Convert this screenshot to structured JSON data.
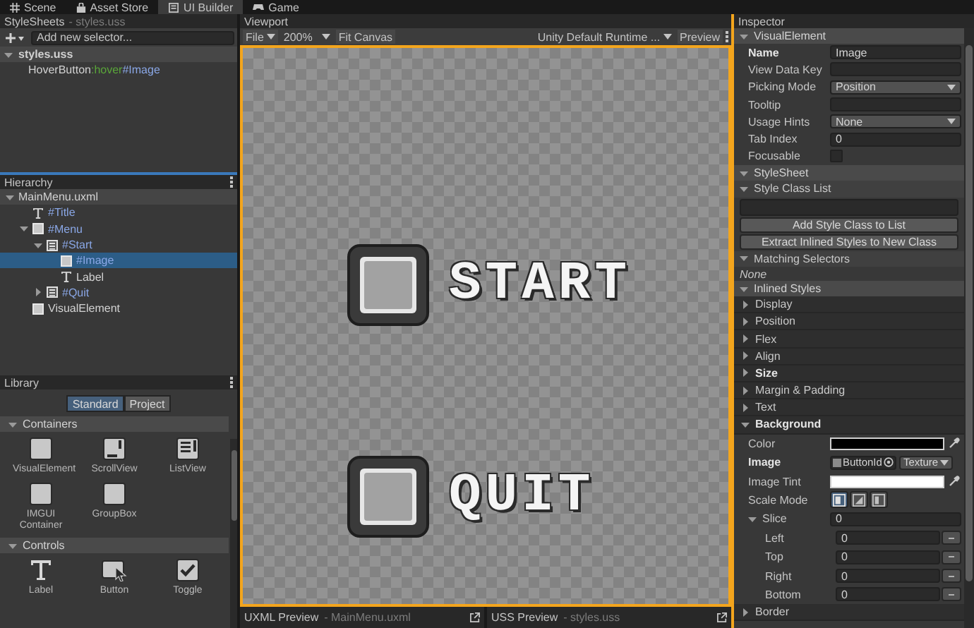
{
  "top_tabs": [
    {
      "label": "Scene",
      "selected": false
    },
    {
      "label": "Asset Store",
      "selected": false
    },
    {
      "label": "UI Builder",
      "selected": true
    },
    {
      "label": "Game",
      "selected": false
    }
  ],
  "stylesheets": {
    "title": "StyleSheets",
    "subtitle": "- styles.uss",
    "selector_placeholder": "Add new selector...",
    "items": [
      {
        "label": "styles.uss",
        "expanded": true,
        "selectors": [
          [
            {
              "text": "HoverButton",
              "kind": "class"
            },
            {
              "text": ":hover",
              "kind": "pseudo"
            },
            {
              "text": "#Image",
              "kind": "id"
            }
          ]
        ]
      }
    ]
  },
  "hierarchy": {
    "title": "Hierarchy",
    "items": [
      {
        "label": "MainMenu.uxml",
        "named": false,
        "selected": false,
        "expanded": true,
        "children": [
          {
            "label": "#Title",
            "kind": "text",
            "named": true,
            "selected": false
          },
          {
            "label": "#Menu",
            "kind": "element",
            "named": true,
            "selected": false,
            "expanded": true,
            "children": [
              {
                "label": "#Start",
                "kind": "template",
                "named": true,
                "selected": false,
                "expanded": true,
                "children": [
                  {
                    "label": "#Image",
                    "kind": "element",
                    "named": true,
                    "selected": true
                  },
                  {
                    "label": "Label",
                    "kind": "text",
                    "named": false,
                    "selected": false
                  }
                ]
              },
              {
                "label": "#Quit",
                "kind": "template",
                "named": true,
                "selected": false,
                "expanded": false
              }
            ]
          },
          {
            "label": "VisualElement",
            "kind": "element",
            "named": false,
            "selected": false
          }
        ]
      }
    ]
  },
  "library": {
    "title": "Library",
    "tabs": [
      {
        "label": "Standard",
        "selected": true
      },
      {
        "label": "Project",
        "selected": false
      }
    ],
    "sections": [
      {
        "title": "Containers",
        "expanded": true,
        "items": [
          {
            "label": "VisualElement",
            "kind": "square"
          },
          {
            "label": "ScrollView",
            "kind": "scrollview"
          },
          {
            "label": "ListView",
            "kind": "listview"
          },
          {
            "label": "IMGUI Container",
            "kind": "square"
          },
          {
            "label": "GroupBox",
            "kind": "square"
          }
        ]
      },
      {
        "title": "Controls",
        "expanded": true,
        "items": [
          {
            "label": "Label",
            "kind": "label"
          },
          {
            "label": "Button",
            "kind": "button"
          },
          {
            "label": "Toggle",
            "kind": "toggle"
          }
        ]
      }
    ]
  },
  "viewport": {
    "title": "Viewport",
    "toolbar": {
      "file": "File",
      "zoom": "200%",
      "fit": "Fit Canvas",
      "theme": "Unity Default Runtime ...",
      "preview": "Preview"
    },
    "canvas": {
      "buttons": [
        {
          "label": "START"
        },
        {
          "label": "QUIT"
        }
      ]
    }
  },
  "previews": [
    {
      "title": "UXML Preview",
      "file": "- MainMenu.uxml"
    },
    {
      "title": "USS Preview",
      "file": "- styles.uss"
    }
  ],
  "inspector": {
    "title": "Inspector",
    "sections": [
      {
        "title": "VisualElement",
        "kind": "fields",
        "expanded": true,
        "fields": [
          {
            "label": "Name",
            "kind": "text",
            "value": "Image",
            "overridden": true
          },
          {
            "label": "View Data Key",
            "kind": "text",
            "overridden": false
          },
          {
            "label": "Picking Mode",
            "kind": "dropdown",
            "value": "Position",
            "overridden": false
          },
          {
            "label": "Tooltip",
            "kind": "text",
            "overridden": false
          },
          {
            "label": "Usage Hints",
            "kind": "dropdown",
            "value": "None",
            "overridden": false
          },
          {
            "label": "Tab Index",
            "kind": "text",
            "value": "0",
            "overridden": false
          },
          {
            "label": "Focusable",
            "kind": "checkbox",
            "checked": false,
            "overridden": false
          }
        ]
      },
      {
        "title": "StyleSheet",
        "kind": "stylesheet",
        "expanded": true,
        "class_list": {
          "title": "Style Class List",
          "expanded": true,
          "buttons": [
            "Add Style Class to List",
            "Extract Inlined Styles to New Class"
          ]
        },
        "matching": {
          "title": "Matching Selectors",
          "expanded": true,
          "empty_text": "None"
        }
      },
      {
        "title": "Inlined Styles",
        "kind": "styles",
        "expanded": true,
        "groups": [
          {
            "title": "Display",
            "expanded": false,
            "overridden": false
          },
          {
            "title": "Position",
            "expanded": false,
            "overridden": false
          },
          {
            "title": "Flex",
            "expanded": false,
            "overridden": false
          },
          {
            "title": "Align",
            "expanded": false,
            "overridden": false
          },
          {
            "title": "Size",
            "expanded": false,
            "overridden": true
          },
          {
            "title": "Margin & Padding",
            "expanded": false,
            "overridden": false
          },
          {
            "title": "Text",
            "expanded": false,
            "overridden": false
          },
          {
            "title": "Background",
            "expanded": true,
            "overridden": true,
            "fields": [
              {
                "label": "Color",
                "kind": "color",
                "color": "#000000",
                "overridden": false
              },
              {
                "label": "Image",
                "kind": "object",
                "value": "ButtonId",
                "type": "Texture",
                "overridden": true
              },
              {
                "label": "Image Tint",
                "kind": "color",
                "color": "#ffffff",
                "overridden": false
              },
              {
                "label": "Scale Mode",
                "kind": "toggle_group",
                "options": [
                  {
                    "kind": "stretch",
                    "selected": true
                  },
                  {
                    "kind": "fit",
                    "selected": false
                  },
                  {
                    "kind": "crop",
                    "selected": false
                  }
                ],
                "overridden": false
              },
              {
                "label": "Slice",
                "kind": "foldout_number",
                "value": "0",
                "expanded": true,
                "overridden": false,
                "children": [
                  {
                    "label": "Left",
                    "kind": "number",
                    "value": "0",
                    "overridden": false
                  },
                  {
                    "label": "Top",
                    "kind": "number",
                    "value": "0",
                    "overridden": false
                  },
                  {
                    "label": "Right",
                    "kind": "number",
                    "value": "0",
                    "overridden": false
                  },
                  {
                    "label": "Bottom",
                    "kind": "number",
                    "value": "0",
                    "overridden": false
                  }
                ]
              }
            ]
          },
          {
            "title": "Border",
            "expanded": false,
            "overridden": false
          }
        ]
      }
    ]
  }
}
